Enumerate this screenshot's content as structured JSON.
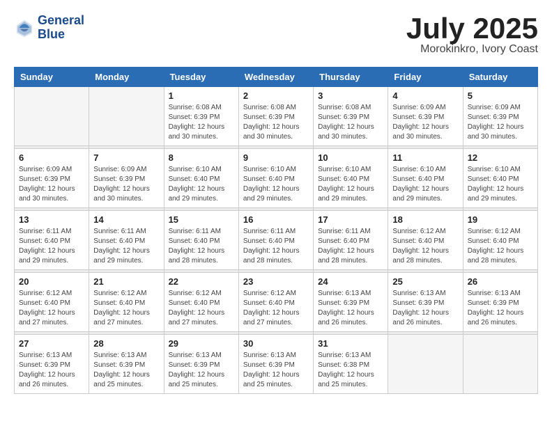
{
  "header": {
    "logo_line1": "General",
    "logo_line2": "Blue",
    "month": "July 2025",
    "location": "Morokinkro, Ivory Coast"
  },
  "weekdays": [
    "Sunday",
    "Monday",
    "Tuesday",
    "Wednesday",
    "Thursday",
    "Friday",
    "Saturday"
  ],
  "weeks": [
    [
      {
        "day": "",
        "info": ""
      },
      {
        "day": "",
        "info": ""
      },
      {
        "day": "1",
        "info": "Sunrise: 6:08 AM\nSunset: 6:39 PM\nDaylight: 12 hours\nand 30 minutes."
      },
      {
        "day": "2",
        "info": "Sunrise: 6:08 AM\nSunset: 6:39 PM\nDaylight: 12 hours\nand 30 minutes."
      },
      {
        "day": "3",
        "info": "Sunrise: 6:08 AM\nSunset: 6:39 PM\nDaylight: 12 hours\nand 30 minutes."
      },
      {
        "day": "4",
        "info": "Sunrise: 6:09 AM\nSunset: 6:39 PM\nDaylight: 12 hours\nand 30 minutes."
      },
      {
        "day": "5",
        "info": "Sunrise: 6:09 AM\nSunset: 6:39 PM\nDaylight: 12 hours\nand 30 minutes."
      }
    ],
    [
      {
        "day": "6",
        "info": "Sunrise: 6:09 AM\nSunset: 6:39 PM\nDaylight: 12 hours\nand 30 minutes."
      },
      {
        "day": "7",
        "info": "Sunrise: 6:09 AM\nSunset: 6:39 PM\nDaylight: 12 hours\nand 30 minutes."
      },
      {
        "day": "8",
        "info": "Sunrise: 6:10 AM\nSunset: 6:40 PM\nDaylight: 12 hours\nand 29 minutes."
      },
      {
        "day": "9",
        "info": "Sunrise: 6:10 AM\nSunset: 6:40 PM\nDaylight: 12 hours\nand 29 minutes."
      },
      {
        "day": "10",
        "info": "Sunrise: 6:10 AM\nSunset: 6:40 PM\nDaylight: 12 hours\nand 29 minutes."
      },
      {
        "day": "11",
        "info": "Sunrise: 6:10 AM\nSunset: 6:40 PM\nDaylight: 12 hours\nand 29 minutes."
      },
      {
        "day": "12",
        "info": "Sunrise: 6:10 AM\nSunset: 6:40 PM\nDaylight: 12 hours\nand 29 minutes."
      }
    ],
    [
      {
        "day": "13",
        "info": "Sunrise: 6:11 AM\nSunset: 6:40 PM\nDaylight: 12 hours\nand 29 minutes."
      },
      {
        "day": "14",
        "info": "Sunrise: 6:11 AM\nSunset: 6:40 PM\nDaylight: 12 hours\nand 29 minutes."
      },
      {
        "day": "15",
        "info": "Sunrise: 6:11 AM\nSunset: 6:40 PM\nDaylight: 12 hours\nand 28 minutes."
      },
      {
        "day": "16",
        "info": "Sunrise: 6:11 AM\nSunset: 6:40 PM\nDaylight: 12 hours\nand 28 minutes."
      },
      {
        "day": "17",
        "info": "Sunrise: 6:11 AM\nSunset: 6:40 PM\nDaylight: 12 hours\nand 28 minutes."
      },
      {
        "day": "18",
        "info": "Sunrise: 6:12 AM\nSunset: 6:40 PM\nDaylight: 12 hours\nand 28 minutes."
      },
      {
        "day": "19",
        "info": "Sunrise: 6:12 AM\nSunset: 6:40 PM\nDaylight: 12 hours\nand 28 minutes."
      }
    ],
    [
      {
        "day": "20",
        "info": "Sunrise: 6:12 AM\nSunset: 6:40 PM\nDaylight: 12 hours\nand 27 minutes."
      },
      {
        "day": "21",
        "info": "Sunrise: 6:12 AM\nSunset: 6:40 PM\nDaylight: 12 hours\nand 27 minutes."
      },
      {
        "day": "22",
        "info": "Sunrise: 6:12 AM\nSunset: 6:40 PM\nDaylight: 12 hours\nand 27 minutes."
      },
      {
        "day": "23",
        "info": "Sunrise: 6:12 AM\nSunset: 6:40 PM\nDaylight: 12 hours\nand 27 minutes."
      },
      {
        "day": "24",
        "info": "Sunrise: 6:13 AM\nSunset: 6:39 PM\nDaylight: 12 hours\nand 26 minutes."
      },
      {
        "day": "25",
        "info": "Sunrise: 6:13 AM\nSunset: 6:39 PM\nDaylight: 12 hours\nand 26 minutes."
      },
      {
        "day": "26",
        "info": "Sunrise: 6:13 AM\nSunset: 6:39 PM\nDaylight: 12 hours\nand 26 minutes."
      }
    ],
    [
      {
        "day": "27",
        "info": "Sunrise: 6:13 AM\nSunset: 6:39 PM\nDaylight: 12 hours\nand 26 minutes."
      },
      {
        "day": "28",
        "info": "Sunrise: 6:13 AM\nSunset: 6:39 PM\nDaylight: 12 hours\nand 25 minutes."
      },
      {
        "day": "29",
        "info": "Sunrise: 6:13 AM\nSunset: 6:39 PM\nDaylight: 12 hours\nand 25 minutes."
      },
      {
        "day": "30",
        "info": "Sunrise: 6:13 AM\nSunset: 6:39 PM\nDaylight: 12 hours\nand 25 minutes."
      },
      {
        "day": "31",
        "info": "Sunrise: 6:13 AM\nSunset: 6:38 PM\nDaylight: 12 hours\nand 25 minutes."
      },
      {
        "day": "",
        "info": ""
      },
      {
        "day": "",
        "info": ""
      }
    ]
  ]
}
